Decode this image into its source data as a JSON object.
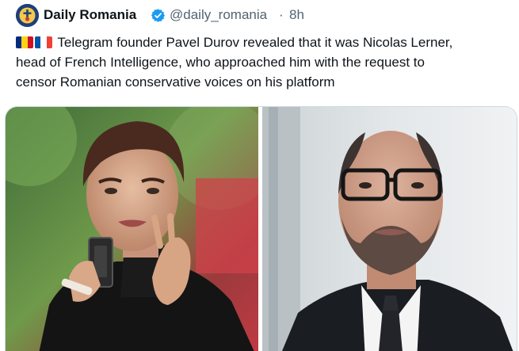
{
  "tweet": {
    "author_name": "Daily Romania",
    "handle": "@daily_romania",
    "separator": "·",
    "time": "8h",
    "text_line1": "Telegram founder Pavel Durov revealed that it was Nicolas Lerner,",
    "text_line2": "head of French Intelligence, who approached him with the request to",
    "text_line3": "censor Romanian conservative voices on his platform",
    "flags": [
      "romania-flag",
      "france-flag"
    ],
    "verified_icon": "verified-badge-icon"
  },
  "media": {
    "photos": [
      "photo-pavel-durov",
      "photo-nicolas-lerner"
    ]
  },
  "colors": {
    "text_primary": "#0f1419",
    "text_secondary": "#536471",
    "verified_blue": "#1d9bf0",
    "border": "#cfd9de"
  }
}
